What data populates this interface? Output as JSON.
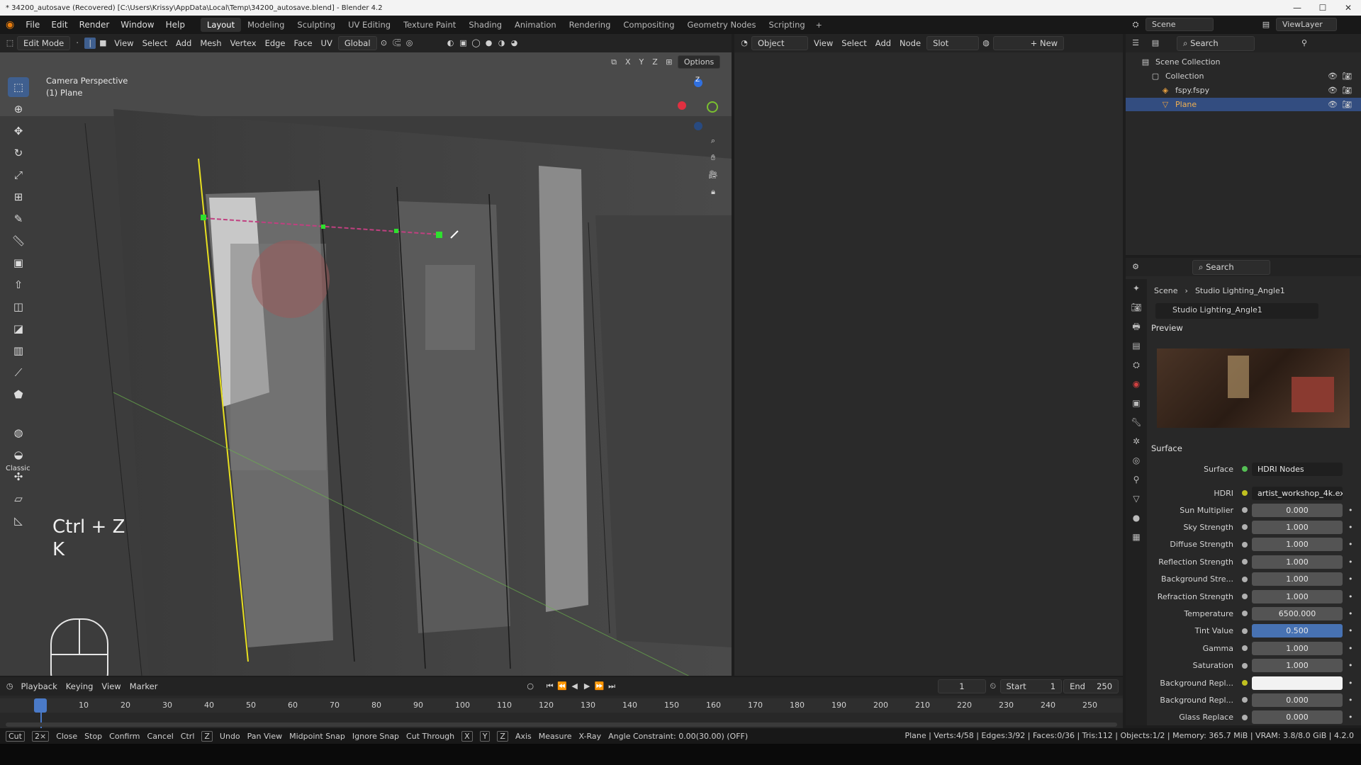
{
  "window": {
    "title": "* 34200_autosave (Recovered) [C:\\Users\\Krissy\\AppData\\Local\\Temp\\34200_autosave.blend] - Blender 4.2",
    "min": "—",
    "max": "☐",
    "close": "✕"
  },
  "menu": [
    "File",
    "Edit",
    "Render",
    "Window",
    "Help"
  ],
  "workspaces": [
    "Layout",
    "Modeling",
    "Sculpting",
    "UV Editing",
    "Texture Paint",
    "Shading",
    "Animation",
    "Rendering",
    "Compositing",
    "Geometry Nodes",
    "Scripting"
  ],
  "active_workspace": "Layout",
  "scene": "Scene",
  "viewlayer": "ViewLayer",
  "viewport_header": {
    "mode": "Edit Mode",
    "items": [
      "View",
      "Select",
      "Add",
      "Mesh",
      "Vertex",
      "Edge",
      "Face",
      "UV"
    ],
    "transform": "Global",
    "options": "Options",
    "axes": [
      "X",
      "Y",
      "Z"
    ]
  },
  "viewport": {
    "camera_label": "Camera Perspective",
    "object_label": "(1) Plane",
    "shortcut1": "Ctrl + Z",
    "shortcut2": "K",
    "gizmo_z": "Z"
  },
  "tools": [
    "select-box",
    "cursor",
    "move",
    "rotate",
    "scale",
    "transform",
    "annotate",
    "measure",
    "add-cube",
    "extrude",
    "inset",
    "bevel",
    "loop-cut",
    "knife",
    "poly-build",
    "spin",
    "smooth",
    "shrink",
    "shear",
    "rip"
  ],
  "tool_classic": "Classic",
  "node_header": {
    "type": "Object",
    "items": [
      "View",
      "Select",
      "Add",
      "Node"
    ],
    "slot": "Slot",
    "new": "New"
  },
  "outliner": {
    "search": "Search",
    "items": [
      {
        "name": "Scene Collection",
        "level": 0
      },
      {
        "name": "Collection",
        "level": 1
      },
      {
        "name": "fspy.fspy",
        "level": 2
      },
      {
        "name": "Plane",
        "level": 2,
        "selected": true
      }
    ]
  },
  "properties": {
    "search": "Search",
    "breadcrumb": [
      "Scene",
      "Studio Lighting_Angle1"
    ],
    "world": "Studio Lighting_Angle1",
    "preview": "Preview",
    "surface_section": "Surface",
    "surface_label": "Surface",
    "surface_value": "HDRI Nodes",
    "hdri_label": "HDRI",
    "hdri_value": "artist_workshop_4k.exr....",
    "fields": [
      {
        "label": "Sun Multiplier",
        "value": "0.000"
      },
      {
        "label": "Sky Strength",
        "value": "1.000"
      },
      {
        "label": "Diffuse Strength",
        "value": "1.000"
      },
      {
        "label": "Reflection Strength",
        "value": "1.000"
      },
      {
        "label": "Background Stre...",
        "value": "1.000"
      },
      {
        "label": "Refraction Strength",
        "value": "1.000"
      },
      {
        "label": "Temperature",
        "value": "6500.000"
      },
      {
        "label": "Tint Value",
        "value": "0.500",
        "highlight": true
      },
      {
        "label": "Gamma",
        "value": "1.000"
      },
      {
        "label": "Saturation",
        "value": "1.000"
      },
      {
        "label": "Background Repl...",
        "value": "",
        "white": true
      },
      {
        "label": "Background Repl...",
        "value": "0.000"
      },
      {
        "label": "Glass Replace",
        "value": "0.000"
      }
    ]
  },
  "timeline": {
    "menus": [
      "Playback",
      "Keying",
      "View",
      "Marker"
    ],
    "current": "1",
    "start_label": "Start",
    "start": "1",
    "end_label": "End",
    "end": "250",
    "ticks": [
      "1",
      "10",
      "20",
      "30",
      "40",
      "50",
      "60",
      "70",
      "80",
      "90",
      "100",
      "110",
      "120",
      "130",
      "140",
      "150",
      "160",
      "170",
      "180",
      "190",
      "200",
      "210",
      "220",
      "230",
      "240",
      "250"
    ]
  },
  "status": [
    "Cut",
    "2×",
    "Close",
    "Stop",
    "Confirm",
    "Cancel",
    "Ctrl",
    "Z",
    "Undo",
    "Pan View",
    "Midpoint Snap",
    "Ignore Snap",
    "Cut Through",
    "X",
    "Y",
    "Z",
    "Axis",
    "Measure",
    "X-Ray",
    "Angle Constraint: 0.00(30.00) (OFF)"
  ],
  "status_right": "Plane | Verts:4/58 | Edges:3/92 | Faces:0/36 | Tris:112 | Objects:1/2 | Memory: 365.7 MiB | VRAM: 3.8/8.0 GiB | 4.2.0"
}
